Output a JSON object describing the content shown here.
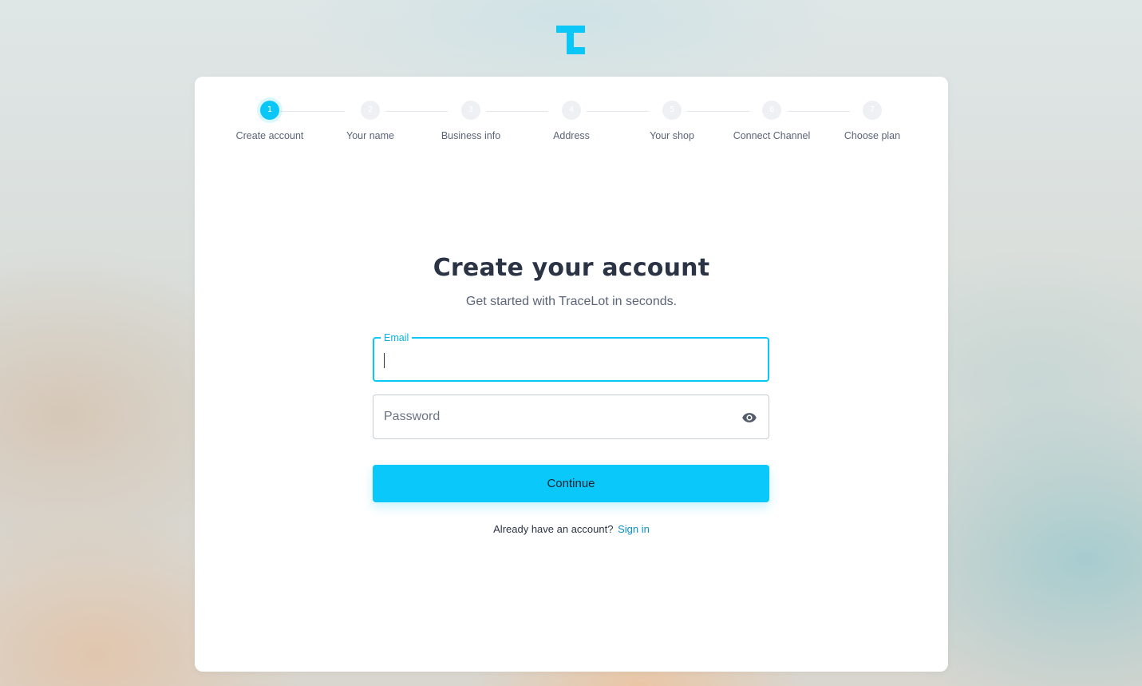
{
  "brand": {
    "name": "TraceLot",
    "logo_icon": "tracelot-t-logo-icon",
    "accent_color": "#0bc7f7"
  },
  "stepper": {
    "steps": [
      {
        "number": "1",
        "label": "Create account",
        "active": true
      },
      {
        "number": "2",
        "label": "Your name",
        "active": false
      },
      {
        "number": "3",
        "label": "Business info",
        "active": false
      },
      {
        "number": "4",
        "label": "Address",
        "active": false
      },
      {
        "number": "5",
        "label": "Your shop",
        "active": false
      },
      {
        "number": "6",
        "label": "Connect Channel",
        "active": false
      },
      {
        "number": "7",
        "label": "Choose plan",
        "active": false
      }
    ]
  },
  "form": {
    "title": "Create your account",
    "subtitle": "Get started with TraceLot in seconds.",
    "email": {
      "label": "Email",
      "value": ""
    },
    "password": {
      "placeholder": "Password",
      "value": "",
      "toggle_icon": "eye-icon"
    },
    "continue_label": "Continue",
    "signin_prompt": "Already have an account?",
    "signin_link": "Sign in"
  }
}
